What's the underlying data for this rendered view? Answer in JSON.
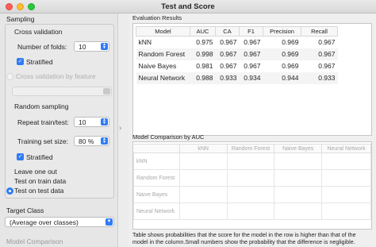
{
  "window": {
    "title": "Test and Score"
  },
  "sampling": {
    "section_label": "Sampling",
    "cross_validation": "Cross validation",
    "number_of_folds_label": "Number of folds:",
    "number_of_folds_value": "10",
    "stratified_label": "Stratified",
    "cross_validation_by_feature": "Cross validation by feature",
    "random_sampling": "Random sampling",
    "repeat_label": "Repeat train/test:",
    "repeat_value": "10",
    "training_size_label": "Training set size:",
    "training_size_value": "80 %",
    "stratified2_label": "Stratified",
    "leave_one_out": "Leave one out",
    "test_on_train": "Test on train data",
    "test_on_test": "Test on test data"
  },
  "target_class": {
    "section_label": "Target Class",
    "value": "(Average over classes)"
  },
  "model_comparison_label": "Model Comparison",
  "evaluation": {
    "section_label": "Evaluation Results",
    "columns": [
      "Model",
      "AUC",
      "CA",
      "F1",
      "Precision",
      "Recall"
    ],
    "rows": [
      [
        "kNN",
        "0.975",
        "0.967",
        "0.967",
        "0.969",
        "0.967"
      ],
      [
        "Random Forest",
        "0.998",
        "0.967",
        "0.967",
        "0.969",
        "0.967"
      ],
      [
        "Naive Bayes",
        "0.981",
        "0.967",
        "0.967",
        "0.969",
        "0.967"
      ],
      [
        "Neural Network",
        "0.988",
        "0.933",
        "0.934",
        "0.944",
        "0.933"
      ]
    ]
  },
  "comparison": {
    "section_label": "Model Comparison by AUC",
    "columns": [
      "kNN",
      "Random Forest",
      "Naive Bayes",
      "Neural Network"
    ],
    "rows": [
      "kNN",
      "Random Forest",
      "Naive Bayes",
      "Neural Network"
    ],
    "note": "Table shows probabilities that the score for the model in the row is higher than that of the model in the column.Small numbers show the probability that the difference is negligible."
  },
  "icons": {
    "stepper": "up-down-arrows-icon",
    "checkbox": "checkmark-icon",
    "dropdown": "chevron-down-icon",
    "splitter": "chevron-right-icon"
  },
  "colors": {
    "accent": "#2f7cf6"
  }
}
